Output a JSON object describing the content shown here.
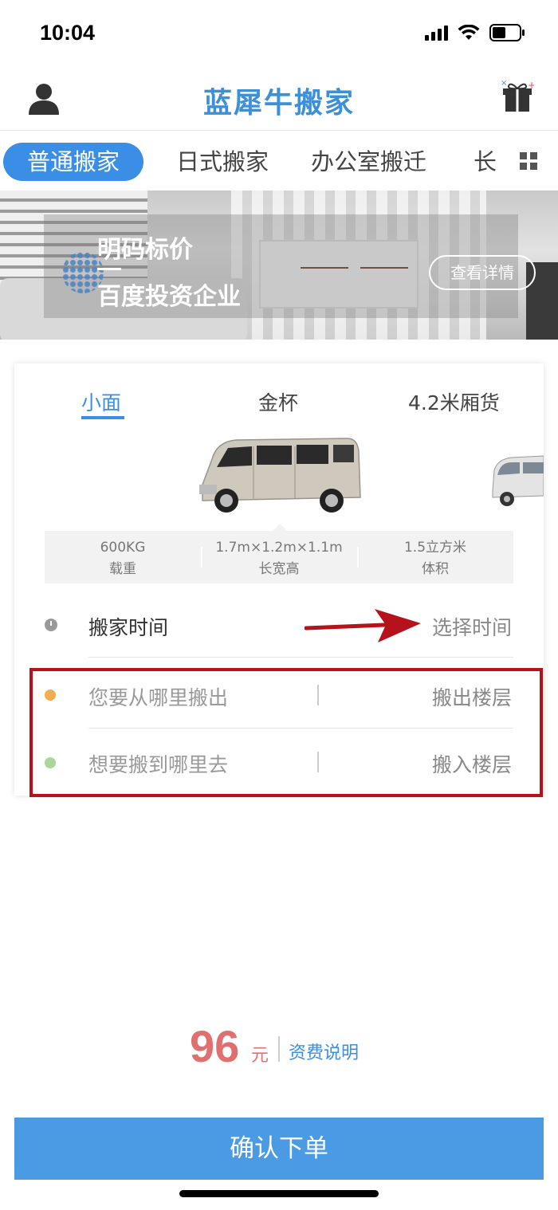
{
  "status_bar": {
    "time": "10:04"
  },
  "header": {
    "title": "蓝犀牛搬家"
  },
  "tabs": [
    {
      "label": "普通搬家",
      "active": true
    },
    {
      "label": "日式搬家",
      "active": false
    },
    {
      "label": "办公室搬迁",
      "active": false
    },
    {
      "label": "长",
      "active": false
    }
  ],
  "banner": {
    "line1": "明码标价",
    "line2": "百度投资企业",
    "detail_button": "查看详情"
  },
  "vehicle_tabs": [
    {
      "label": "小面",
      "active": true
    },
    {
      "label": "金杯",
      "active": false
    },
    {
      "label": "4.2米厢货",
      "active": false
    }
  ],
  "specs": [
    {
      "value": "600KG",
      "label": "载重"
    },
    {
      "value": "1.7m×1.2m×1.1m",
      "label": "长宽高"
    },
    {
      "value": "1.5立方米",
      "label": "体积"
    }
  ],
  "move_time": {
    "label": "搬家时间",
    "action": "选择时间"
  },
  "from": {
    "placeholder": "您要从哪里搬出",
    "floor": "搬出楼层",
    "dot_color": "#f2ad4e"
  },
  "to": {
    "placeholder": "想要搬到哪里去",
    "floor": "搬入楼层",
    "dot_color": "#a9d89a"
  },
  "price": {
    "amount": "96",
    "unit": "元",
    "fee_link": "资费说明"
  },
  "confirm_button": "确认下单",
  "colors": {
    "accent": "#3a8ee6",
    "price": "#e07070",
    "highlight": "#b5121b"
  }
}
